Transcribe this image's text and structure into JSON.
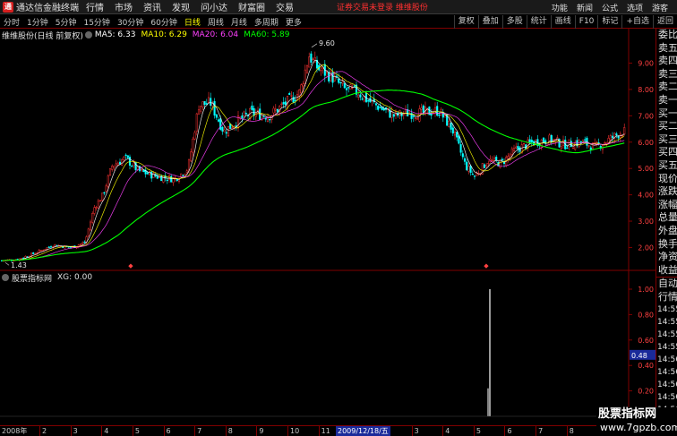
{
  "app": {
    "title": "通达信金融终端",
    "logo_glyph": "通"
  },
  "menu": [
    "行情",
    "市场",
    "资讯",
    "发现",
    "问小达",
    "财富圈",
    "交易"
  ],
  "status_text": "证券交易未登录  维维股份",
  "menu_right": [
    "功能",
    "新闻",
    "公式",
    "选项",
    "游客"
  ],
  "periods": [
    {
      "label": "分时",
      "active": false
    },
    {
      "label": "1分钟",
      "active": false
    },
    {
      "label": "5分钟",
      "active": false
    },
    {
      "label": "15分钟",
      "active": false
    },
    {
      "label": "30分钟",
      "active": false
    },
    {
      "label": "60分钟",
      "active": false
    },
    {
      "label": "日线",
      "active": true
    },
    {
      "label": "周线",
      "active": false
    },
    {
      "label": "月线",
      "active": false
    },
    {
      "label": "多周期",
      "active": false
    },
    {
      "label": "更多",
      "active": false
    }
  ],
  "tools": [
    "复权",
    "叠加",
    "多股",
    "统计",
    "画线",
    "F10",
    "标记",
    "+自选",
    "返回"
  ],
  "main_chart": {
    "stock_label": "维维股份(日线 前复权)",
    "ma": [
      {
        "label": "MA5: 6.33",
        "color": "#ffffff"
      },
      {
        "label": "MA10: 6.29",
        "color": "#ffff00"
      },
      {
        "label": "MA20: 6.04",
        "color": "#ff40ff"
      },
      {
        "label": "MA60: 5.89",
        "color": "#00ff00"
      }
    ],
    "high_label": "9.60",
    "low_label": "1.43",
    "y_ticks": [
      "9.00",
      "8.00",
      "7.00",
      "6.00",
      "5.00",
      "4.00",
      "3.00",
      "2.00"
    ]
  },
  "sub_chart": {
    "label": "股票指标网",
    "indicator": "XG: 0.00",
    "y_ticks": [
      "1.00",
      "0.80",
      "0.60",
      "0.40",
      "0.20"
    ],
    "cursor_value": "0.48"
  },
  "right_panel": {
    "labels": [
      "委比",
      "卖五",
      "卖四",
      "卖三",
      "卖二",
      "卖一",
      "买一",
      "买二",
      "买三",
      "买四",
      "买五",
      "现价",
      "涨跌",
      "涨幅",
      "总量",
      "外盘",
      "换手",
      "净资",
      "收益"
    ],
    "tick_header": [
      "自动",
      "行情"
    ],
    "times": [
      "14:55",
      "14:55",
      "14:55",
      "14:55",
      "14:56",
      "14:56",
      "14:56",
      "14:56",
      "14:56",
      "14:56"
    ]
  },
  "date_axis": {
    "start": "2008年",
    "months": [
      "2",
      "3",
      "4",
      "5",
      "6",
      "7",
      "8",
      "9",
      "10",
      "11",
      "12",
      "2",
      "3",
      "4",
      "5",
      "6",
      "7",
      "8",
      "9"
    ],
    "cursor_date": "2009/12/18/五"
  },
  "watermark": {
    "line1": "股票指标网",
    "line2": "www.7gpzb.com"
  },
  "colors": {
    "up": "#ff3232",
    "down": "#00ffff",
    "ma5": "#ffffff",
    "ma10": "#ffff00",
    "ma20": "#ff40ff",
    "ma60": "#00ff00",
    "frame": "#800000"
  }
}
